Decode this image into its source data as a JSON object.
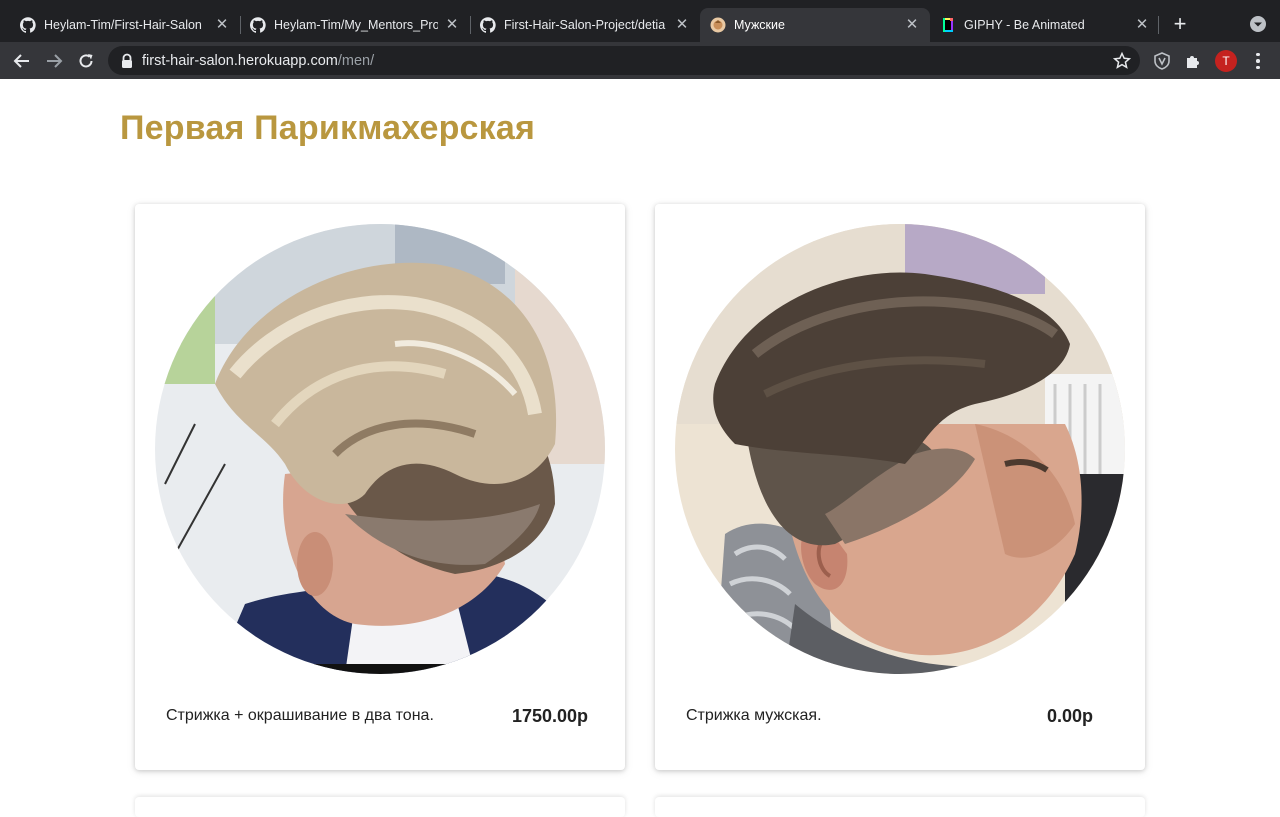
{
  "browser": {
    "tabs": [
      {
        "title": "Heylam-Tim/First-Hair-Salon",
        "icon": "github-icon",
        "active": false
      },
      {
        "title": "Heylam-Tim/My_Mentors_Pro",
        "icon": "github-icon",
        "active": false
      },
      {
        "title": "First-Hair-Salon-Project/detia",
        "icon": "github-icon",
        "active": false
      },
      {
        "title": "Мужские",
        "icon": "salon-favicon-icon",
        "active": true
      },
      {
        "title": "GIPHY - Be Animated",
        "icon": "giphy-icon",
        "active": false
      }
    ],
    "url_host": "first-hair-salon.herokuapp.com",
    "url_path": "/men/",
    "profile_initial": "T",
    "accent_color": "#c5221f"
  },
  "page": {
    "site_title": "Первая Парикмахерская",
    "title_color": "#b9973f",
    "services": [
      {
        "name": "Стрижка + окрашивание в два тона.",
        "price": "1750.00р",
        "photo": "blond-two-tone-haircut-photo"
      },
      {
        "name": "Стрижка мужская.",
        "price": "0.00р",
        "photo": "mens-haircut-photo"
      }
    ]
  }
}
